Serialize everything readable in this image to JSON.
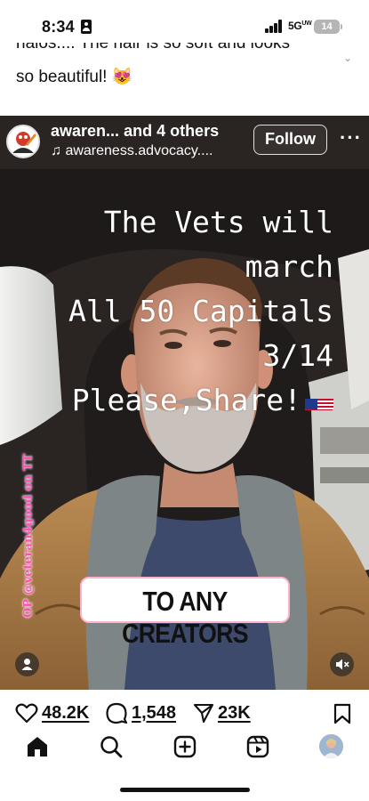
{
  "status_bar": {
    "time": "8:34",
    "network": "5G",
    "network_sup": "UW",
    "battery": "14"
  },
  "caption": {
    "line1_partial": "halos.... The hair is so soft and looks",
    "line2": "so beautiful! 😻"
  },
  "reel": {
    "author": "awaren...",
    "author_others": "and 4 others",
    "audio": "awareness.advocacy....",
    "follow_label": "Follow",
    "more_label": "···",
    "overlay_lines": [
      "The Vets will",
      "march",
      "All 50 Capitals",
      "3/14",
      "Please,Share!"
    ],
    "watermark": "OP @veteran4good on TT",
    "caption_sticker_1": "TO ANY",
    "caption_sticker_2": "CREATORS",
    "icons": {
      "tag": "person-tag-icon",
      "mute": "speaker-muted-icon"
    }
  },
  "actions": {
    "likes": "48.2K",
    "comments": "1,548",
    "shares": "23K"
  },
  "colors": {
    "watermark": "#ff4fb4",
    "battery": "#b5b5b5"
  }
}
